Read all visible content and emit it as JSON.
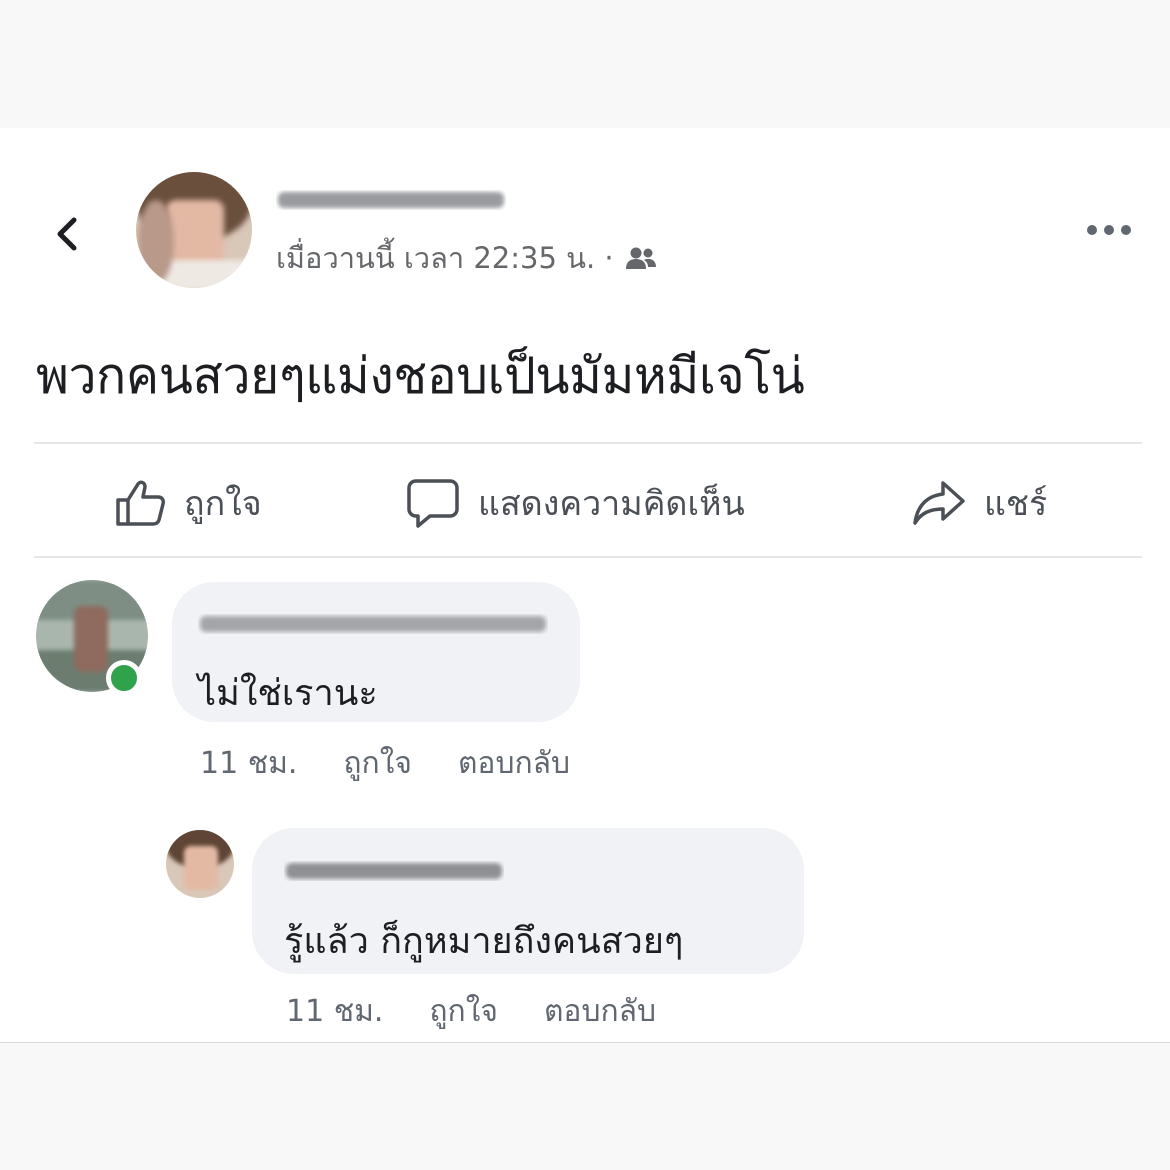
{
  "post": {
    "timestamp": "เมื่อวานนี้ เวลา 22:35 น. ·",
    "text": "พวกคนสวยๆแม่งชอบเป็นมัมหมีเจโน่",
    "icons": {
      "back": "chevron-left-icon",
      "audience": "friends-icon",
      "more": "more-horizontal-icon"
    }
  },
  "actions": {
    "like_label": "ถูกใจ",
    "comment_label": "แสดงความคิดเห็น",
    "share_label": "แชร์"
  },
  "comments": [
    {
      "text": "ไม่ใช่เรานะ",
      "time": "11 ชม.",
      "like_label": "ถูกใจ",
      "reply_label": "ตอบกลับ",
      "online": true
    },
    {
      "text": "รู้แล้ว ก็กูหมายถึงคนสวยๆ",
      "time": "11 ชม.",
      "like_label": "ถูกใจ",
      "reply_label": "ตอบกลับ"
    }
  ],
  "colors": {
    "online": "#31a24c",
    "secondary_text": "#65676b",
    "bubble": "#f0f2f5"
  }
}
